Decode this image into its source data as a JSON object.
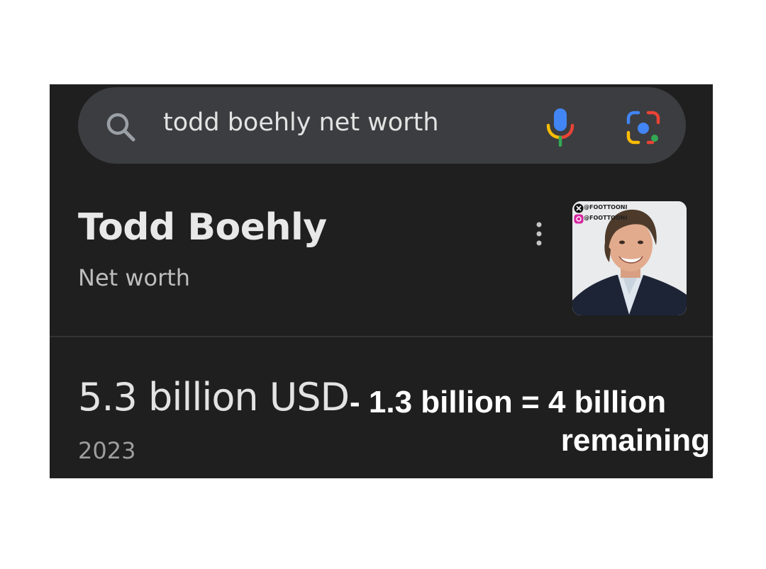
{
  "search": {
    "query": "todd boehly net worth",
    "icons": {
      "search": "search-icon",
      "voice": "microphone-icon",
      "lens": "camera-lens-icon"
    }
  },
  "entity": {
    "title": "Todd Boehly",
    "subtitle": "Net worth",
    "menu_icon": "more-vert-icon",
    "avatar": {
      "watermark_lines": [
        "@FOOTTOONI",
        "@FOOTTOONI"
      ]
    }
  },
  "answer": {
    "value": "5.3 billion USD",
    "year": "2023"
  },
  "overlay": {
    "line1": "- 1.3 billion = 4 billion",
    "line2": "remaining"
  },
  "colors": {
    "screen_bg": "#1f1f1f",
    "search_bg": "#3c3d40",
    "google_blue": "#4285f4",
    "google_red": "#ea4335",
    "google_yellow": "#fbbc04",
    "google_green": "#34a853"
  }
}
